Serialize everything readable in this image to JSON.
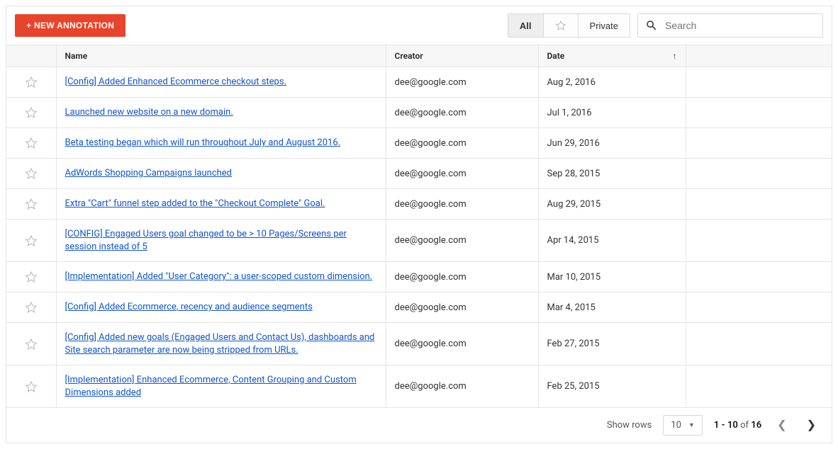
{
  "toolbar": {
    "new_annotation_label": "+ NEW ANNOTATION",
    "filter_all": "All",
    "filter_private": "Private",
    "search_placeholder": "Search"
  },
  "columns": {
    "name": "Name",
    "creator": "Creator",
    "date": "Date"
  },
  "rows": [
    {
      "name": "[Config] Added Enhanced Ecommerce checkout steps.",
      "creator": "dee@google.com",
      "date": "Aug 2, 2016"
    },
    {
      "name": "Launched new website on a new domain.",
      "creator": "dee@google.com",
      "date": "Jul 1, 2016"
    },
    {
      "name": "Beta testing began which will run throughout July and August 2016.",
      "creator": "dee@google.com",
      "date": "Jun 29, 2016"
    },
    {
      "name": "AdWords Shopping Campaigns launched",
      "creator": "dee@google.com",
      "date": "Sep 28, 2015"
    },
    {
      "name": "Extra \"Cart\" funnel step added to the \"Checkout Complete\" Goal.",
      "creator": "dee@google.com",
      "date": "Aug 29, 2015"
    },
    {
      "name": "[CONFIG] Engaged Users goal changed to be > 10 Pages/Screens per session instead of 5",
      "creator": "dee@google.com",
      "date": "Apr 14, 2015"
    },
    {
      "name": "[Implementation] Added \"User Category\": a user-scoped custom dimension.",
      "creator": "dee@google.com",
      "date": "Mar 10, 2015"
    },
    {
      "name": "[Config] Added Ecommerce, recency and audience segments",
      "creator": "dee@google.com",
      "date": "Mar 4, 2015"
    },
    {
      "name": "[Config] Added new goals (Engaged Users and Contact Us), dashboards and Site search parameter are now being stripped from URLs.",
      "creator": "dee@google.com",
      "date": "Feb 27, 2015"
    },
    {
      "name": "[Implementation] Enhanced Ecommerce, Content Grouping and Custom Dimensions added",
      "creator": "dee@google.com",
      "date": "Feb 25, 2015"
    }
  ],
  "pager": {
    "show_rows_label": "Show rows",
    "rows_per_page": "10",
    "range_start": "1",
    "range_end": "10",
    "of_label": "of",
    "total": "16"
  }
}
